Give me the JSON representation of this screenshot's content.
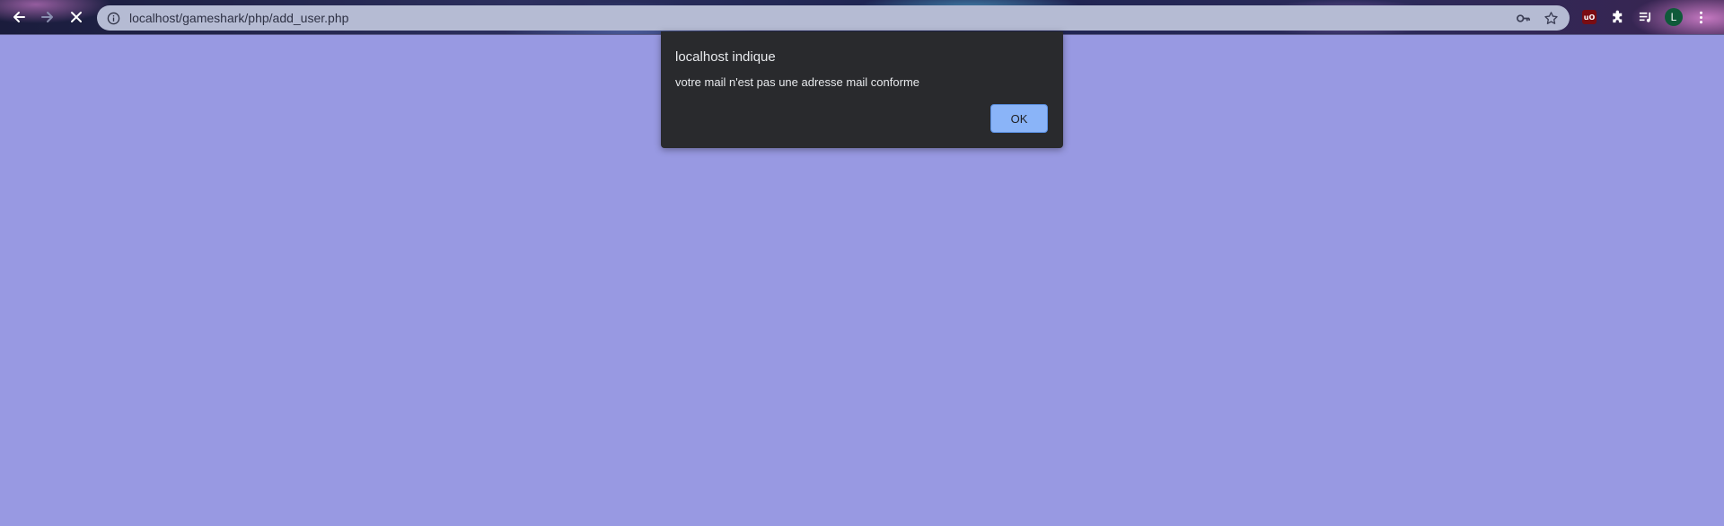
{
  "browser": {
    "url": "localhost/gameshark/php/add_user.php",
    "avatar_letter": "L",
    "ublock_label": "uO",
    "icons": {
      "back": "arrow-left-icon",
      "forward": "arrow-right-icon",
      "stop": "close-icon",
      "site_info": "info-icon",
      "password": "key-icon",
      "bookmark": "star-icon",
      "extensions": "puzzle-icon",
      "media": "playlist-icon",
      "menu": "kebab-menu-icon"
    }
  },
  "dialog": {
    "title": "localhost indique",
    "message": "votre mail n'est pas une adresse mail conforme",
    "ok_label": "OK"
  },
  "colors": {
    "page_background": "#9899e2",
    "dialog_background": "#292a2d",
    "ok_button": "#8ab4f8"
  }
}
